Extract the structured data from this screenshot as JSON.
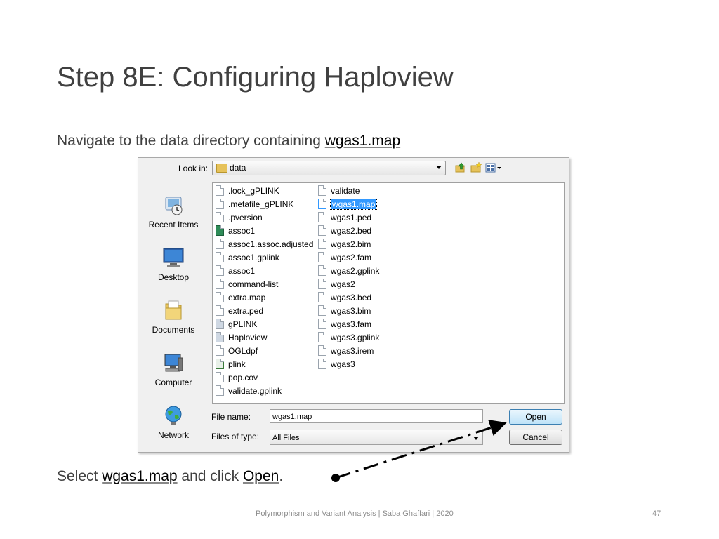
{
  "slide": {
    "title": "Step 8E: Configuring Haploview",
    "subtitle_pre": "Navigate to the data directory containing ",
    "subtitle_file": "wgas1.map",
    "bottom_pre": "Select ",
    "bottom_file": "wgas1.map",
    "bottom_mid": " and click ",
    "bottom_action": "Open",
    "bottom_end": ".",
    "footer": "Polymorphism and Variant Analysis | Saba Ghaffari | 2020",
    "page_number": "47"
  },
  "dialog": {
    "look_in_label": "Look in:",
    "look_in_value": "data",
    "places": [
      "Recent Items",
      "Desktop",
      "Documents",
      "Computer",
      "Network"
    ],
    "files_col1": [
      ".lock_gPLINK",
      ".metafile_gPLINK",
      ".pversion",
      "assoc1",
      "assoc1.assoc.adjusted",
      "assoc1.gplink",
      "assoc1",
      "command-list",
      "extra.map",
      "extra.ped",
      "gPLINK",
      "Haploview",
      "OGLdpf",
      "plink",
      "pop.cov",
      "validate.gplink"
    ],
    "files_col2": [
      "validate",
      "wgas1.map",
      "wgas1.ped",
      "wgas2.bed",
      "wgas2.bim",
      "wgas2.fam",
      "wgas2.gplink",
      "wgas2",
      "wgas3.bed",
      "wgas3.bim",
      "wgas3.fam",
      "wgas3.gplink",
      "wgas3.irem",
      "wgas3"
    ],
    "selected_file": "wgas1.map",
    "file_name_label": "File name:",
    "file_name_value": "wgas1.map",
    "file_type_label": "Files of type:",
    "file_type_value": "All Files",
    "open_label": "Open",
    "cancel_label": "Cancel"
  },
  "icons": {
    "toolbar": [
      "up-folder-icon",
      "new-folder-icon",
      "view-menu-icon"
    ],
    "places": [
      "recent-items-icon",
      "desktop-icon",
      "documents-icon",
      "computer-icon",
      "network-icon"
    ]
  }
}
